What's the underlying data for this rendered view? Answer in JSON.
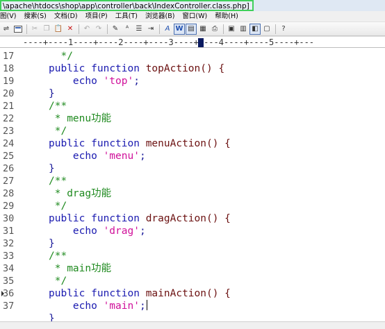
{
  "window": {
    "title": "\\apache\\htdocs\\shop\\app\\controller\\back\\IndexController.class.php]"
  },
  "menu": {
    "items": [
      "图(V)",
      "搜索(S)",
      "文档(D)",
      "项目(P)",
      "工具(T)",
      "浏览器(B)",
      "窗口(W)",
      "帮助(H)"
    ]
  },
  "toolbar": {
    "icons": [
      "wordwrap-icon",
      "document-icon",
      "cut-icon",
      "copy-icon",
      "paste-icon",
      "delete-icon",
      "undo-icon",
      "redo-icon",
      "pen-icon",
      "highlight-icon",
      "list-icon",
      "insert-icon",
      "font-a-icon",
      "bold-w-icon",
      "column-icon",
      "hex-icon",
      "print-preview-icon",
      "window-icon",
      "panel-icon",
      "bookmark-icon",
      "clip-icon",
      "help-icon"
    ]
  },
  "ruler": {
    "text": "----+----1----+----2----+----3----+----4----+----5----+---"
  },
  "editor": {
    "lines": [
      {
        "n": "17",
        "parts": [
          {
            "t": "  */",
            "c": "cm"
          }
        ]
      },
      {
        "n": "18",
        "parts": [
          {
            "t": "public",
            "c": "kw"
          },
          {
            "t": " ",
            "c": "plain"
          },
          {
            "t": "function",
            "c": "kw"
          },
          {
            "t": " topAction() {",
            "c": "fn"
          }
        ]
      },
      {
        "n": "19",
        "parts": [
          {
            "t": "    echo ",
            "c": "kw"
          },
          {
            "t": "'top'",
            "c": "str"
          },
          {
            "t": ";",
            "c": "plain"
          }
        ]
      },
      {
        "n": "20",
        "parts": [
          {
            "t": "}",
            "c": "plain"
          }
        ]
      },
      {
        "n": "21",
        "parts": [
          {
            "t": "/**",
            "c": "cm"
          }
        ]
      },
      {
        "n": "22",
        "parts": [
          {
            "t": " * menu功能",
            "c": "cm"
          }
        ]
      },
      {
        "n": "23",
        "parts": [
          {
            "t": " */",
            "c": "cm"
          }
        ]
      },
      {
        "n": "24",
        "parts": [
          {
            "t": "public",
            "c": "kw"
          },
          {
            "t": " ",
            "c": "plain"
          },
          {
            "t": "function",
            "c": "kw"
          },
          {
            "t": " menuAction() {",
            "c": "fn"
          }
        ]
      },
      {
        "n": "25",
        "parts": [
          {
            "t": "    echo ",
            "c": "kw"
          },
          {
            "t": "'menu'",
            "c": "str"
          },
          {
            "t": ";",
            "c": "plain"
          }
        ]
      },
      {
        "n": "26",
        "parts": [
          {
            "t": "}",
            "c": "plain"
          }
        ]
      },
      {
        "n": "27",
        "parts": [
          {
            "t": "/**",
            "c": "cm"
          }
        ]
      },
      {
        "n": "28",
        "parts": [
          {
            "t": " * drag功能",
            "c": "cm"
          }
        ]
      },
      {
        "n": "29",
        "parts": [
          {
            "t": " */",
            "c": "cm"
          }
        ]
      },
      {
        "n": "30",
        "parts": [
          {
            "t": "public",
            "c": "kw"
          },
          {
            "t": " ",
            "c": "plain"
          },
          {
            "t": "function",
            "c": "kw"
          },
          {
            "t": " dragAction() {",
            "c": "fn"
          }
        ]
      },
      {
        "n": "31",
        "parts": [
          {
            "t": "    echo ",
            "c": "kw"
          },
          {
            "t": "'drag'",
            "c": "str"
          },
          {
            "t": ";",
            "c": "plain"
          }
        ]
      },
      {
        "n": "32",
        "parts": [
          {
            "t": "}",
            "c": "plain"
          }
        ]
      },
      {
        "n": "33",
        "parts": [
          {
            "t": "/**",
            "c": "cm"
          }
        ]
      },
      {
        "n": "34",
        "parts": [
          {
            "t": " * main功能",
            "c": "cm"
          }
        ]
      },
      {
        "n": "35",
        "parts": [
          {
            "t": " */",
            "c": "cm"
          }
        ]
      },
      {
        "n": "36",
        "parts": [
          {
            "t": "public",
            "c": "kw"
          },
          {
            "t": " ",
            "c": "plain"
          },
          {
            "t": "function",
            "c": "kw"
          },
          {
            "t": " mainAction() {",
            "c": "fn"
          }
        ]
      },
      {
        "n": "37",
        "parts": [
          {
            "t": "    echo ",
            "c": "kw"
          },
          {
            "t": "'main'",
            "c": "str"
          },
          {
            "t": ";",
            "c": "plain"
          }
        ],
        "caret": true
      },
      {
        "n": "",
        "parts": [
          {
            "t": "}",
            "c": "plain"
          }
        ]
      }
    ]
  },
  "colors": {
    "keyword": "#1a1ab0",
    "function_name": "#6b1010",
    "string": "#d0109a",
    "comment": "#1f8a1f",
    "title_highlight": "#3fd05a"
  }
}
